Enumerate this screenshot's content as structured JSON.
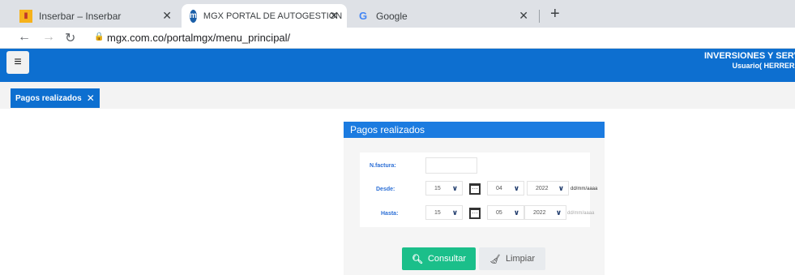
{
  "browser": {
    "tabs": [
      {
        "title": "Inserbar – Inserbar",
        "favicon": "inserbar-icon"
      },
      {
        "title": "MGX PORTAL DE AUTOGESTION",
        "favicon": "mgx-icon"
      },
      {
        "title": "Google",
        "favicon": "google-icon"
      }
    ],
    "url": "mgx.com.co/portalmgx/menu_principal/"
  },
  "header": {
    "company": "INVERSIONES Y SERV",
    "user": "Usuario( HERRERA"
  },
  "app_tab": {
    "label": "Pagos realizados"
  },
  "panel": {
    "title": "Pagos realizados",
    "factura_label": "N.factura:",
    "desde_label": "Desde:",
    "hasta_label": "Hasta:",
    "desde": {
      "day": "15",
      "month": "04",
      "year": "2022",
      "format": "dd/mm/aaaa"
    },
    "hasta": {
      "day": "15",
      "month": "05",
      "year": "2022",
      "format": "dd/mm/aaaa"
    },
    "consultar": "Consultar",
    "limpiar": "Limpiar"
  },
  "colors": {
    "header": "#0d6fd0",
    "consultar": "#1bbf8a",
    "panel_head": "#1b7be0"
  }
}
